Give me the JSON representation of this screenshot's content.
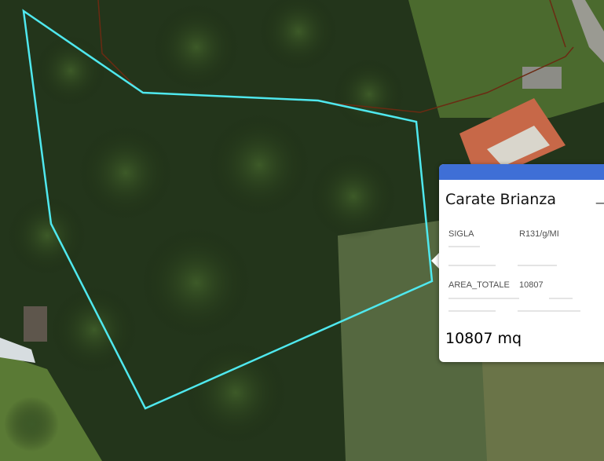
{
  "map": {
    "basemap": "satellite-imagery",
    "parcel_outline_color": "#4fe8ee",
    "cadastral_line_color": "#6b2a12"
  },
  "popup": {
    "title": "Carate Brianza",
    "minimize_symbol": "_",
    "header_color": "#3f6fd6",
    "fields": [
      {
        "key": "SIGLA",
        "value": "R131/g/MI"
      },
      {
        "key": "AREA_TOTALE",
        "value": "10807"
      }
    ],
    "area_text": "10807 mq"
  }
}
